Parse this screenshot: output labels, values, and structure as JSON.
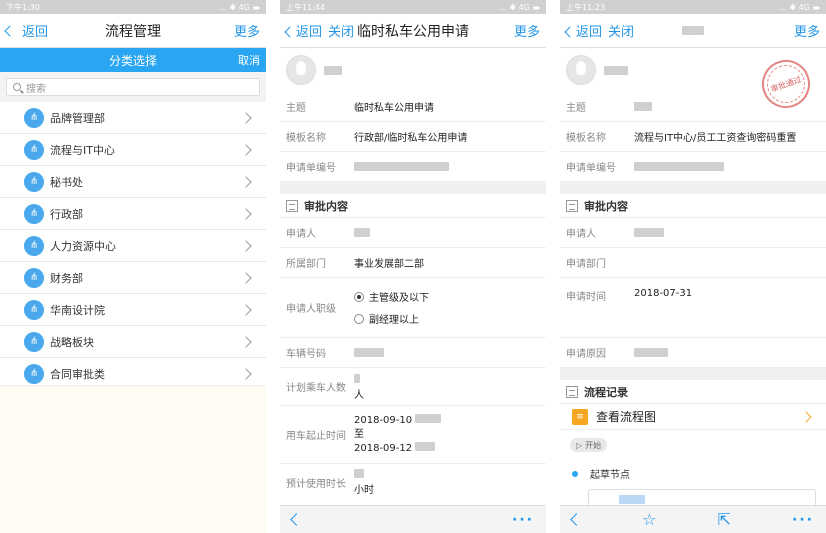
{
  "p1": {
    "status_left": "下午1:30",
    "status_right": "... ✱ 4G ▬",
    "nav": {
      "back": "返回",
      "title": "流程管理",
      "more": "更多"
    },
    "category_bar": {
      "title": "分类选择",
      "cancel": "取消"
    },
    "search_placeholder": "搜索",
    "items": [
      "品牌管理部",
      "流程与IT中心",
      "秘书处",
      "行政部",
      "人力资源中心",
      "财务部",
      "华南设计院",
      "战略板块",
      "合同审批类"
    ]
  },
  "p2": {
    "status_left": "上午11:44",
    "status_right": "... ✱ 4G ▬",
    "nav": {
      "back": "返回",
      "close": "关闭",
      "title": "临时私车公用申请",
      "more": "更多"
    },
    "fields_top": [
      {
        "key": "主题",
        "val": "临时私车公用申请"
      },
      {
        "key": "模板名称",
        "val": "行政部/临时私车公用申请"
      },
      {
        "key": "申请单编号",
        "val": ""
      }
    ],
    "section_title": "审批内容",
    "applicant_label": "申请人",
    "dept_label": "所属部门",
    "dept_value": "事业发展部二部",
    "level_label": "申请人职级",
    "level_options": [
      "主管级及以下",
      "副经理以上"
    ],
    "plate_label": "车辆号码",
    "passengers_label": "计划乘车人数",
    "passengers_unit": "人",
    "period_label": "用车起止时间",
    "period_start": "2018-09-10",
    "period_to": "至",
    "period_end": "2018-09-12",
    "duration_label": "预计使用时长",
    "duration_unit": "小时"
  },
  "p3": {
    "status_left": "上午11:23",
    "status_right": "... ✱ 4G ▬",
    "nav": {
      "back": "返回",
      "close": "关闭",
      "more": "更多"
    },
    "stamp_text": "审批通过",
    "fields_top": [
      {
        "key": "主题",
        "val": ""
      },
      {
        "key": "模板名称",
        "val": "流程与IT中心/员工工资查询密码重置"
      },
      {
        "key": "申请单编号",
        "val": ""
      }
    ],
    "section_title": "审批内容",
    "applicant_label": "申请人",
    "dept_label": "申请部门",
    "time_label": "申请时间",
    "time_value": "2018-07-31",
    "reason_label": "申请原因",
    "flow_section_title": "流程记录",
    "flow_link": "查看流程图",
    "start_label": "开始",
    "draft_node": "起草节点"
  }
}
